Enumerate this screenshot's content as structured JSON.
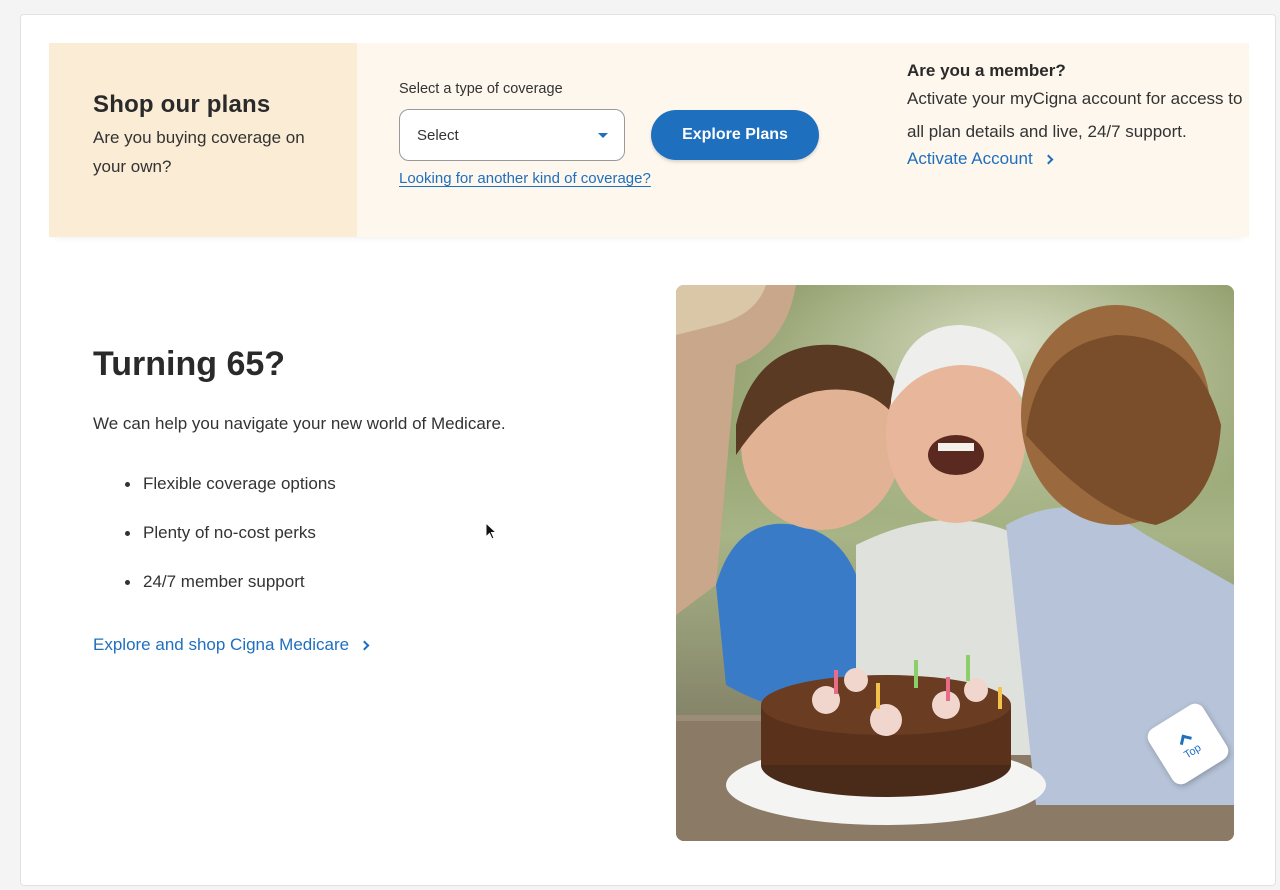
{
  "shop": {
    "title": "Shop our plans",
    "subtitle": "Are you buying coverage on your own?",
    "select_label": "Select a type of coverage",
    "select_value": "Select",
    "explore_button": "Explore Plans",
    "another_link": "Looking for another kind of coverage?"
  },
  "member": {
    "title": "Are you a member?",
    "text": "Activate your myCigna account for access to all plan details and live, 24/7 support.",
    "activate_link": "Activate Account"
  },
  "turning65": {
    "title": "Turning 65?",
    "intro": "We can help you navigate your new world of Medicare.",
    "bullets": [
      "Flexible coverage options",
      "Plenty of no-cost perks",
      "24/7 member support"
    ],
    "cta_link": "Explore and shop Cigna Medicare"
  },
  "top_button": {
    "label": "Top"
  },
  "colors": {
    "accent": "#1f6fbf",
    "band": "#fdf7ed",
    "band_left": "#fbecd6"
  }
}
